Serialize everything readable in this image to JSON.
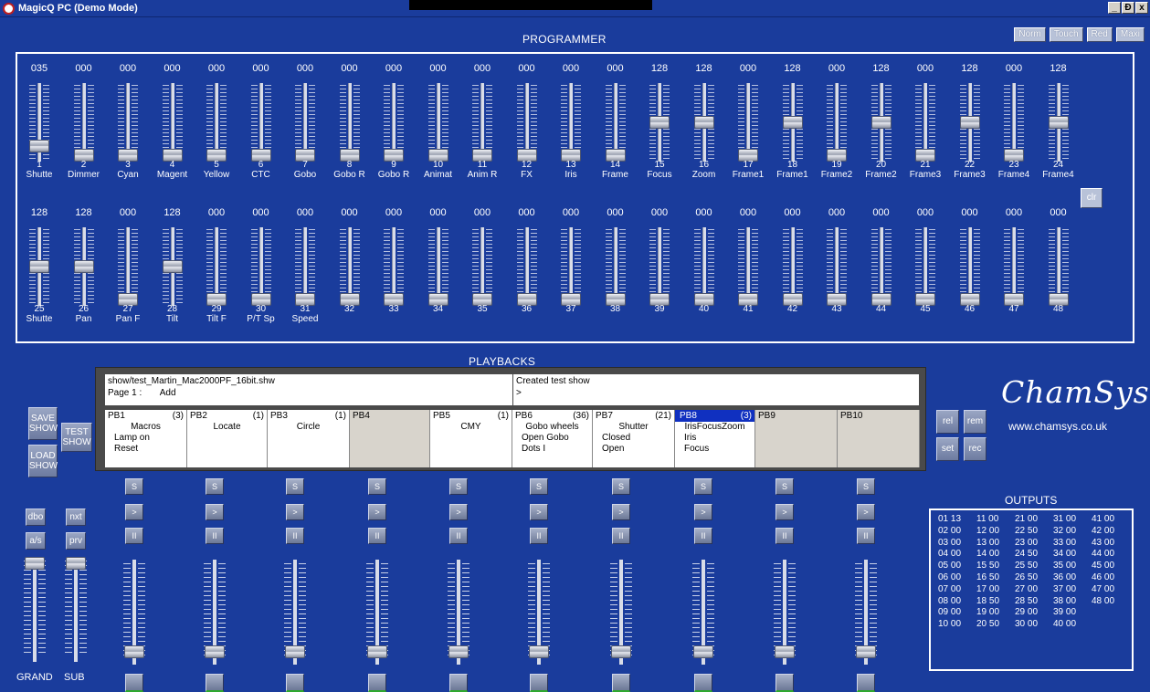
{
  "window": {
    "title": "MagicQ PC (Demo Mode)",
    "controls": [
      "_",
      "Ɖ",
      "x"
    ]
  },
  "modes": [
    "Norm",
    "Touch",
    "Red",
    "Maxi"
  ],
  "programmer": {
    "title": "PROGRAMMER",
    "clear_label": "clr",
    "row1": [
      {
        "value": "035",
        "num": "1",
        "label": "Shutte",
        "level": 35
      },
      {
        "value": "000",
        "num": "2",
        "label": "Dimmer",
        "level": 0
      },
      {
        "value": "000",
        "num": "3",
        "label": "Cyan",
        "level": 0
      },
      {
        "value": "000",
        "num": "4",
        "label": "Magent",
        "level": 0
      },
      {
        "value": "000",
        "num": "5",
        "label": "Yellow",
        "level": 0
      },
      {
        "value": "000",
        "num": "6",
        "label": "CTC",
        "level": 0
      },
      {
        "value": "000",
        "num": "7",
        "label": "Gobo",
        "level": 0
      },
      {
        "value": "000",
        "num": "8",
        "label": "Gobo R",
        "level": 0
      },
      {
        "value": "000",
        "num": "9",
        "label": "Gobo R",
        "level": 0
      },
      {
        "value": "000",
        "num": "10",
        "label": "Animat",
        "level": 0
      },
      {
        "value": "000",
        "num": "11",
        "label": "Anim R",
        "level": 0
      },
      {
        "value": "000",
        "num": "12",
        "label": "FX",
        "level": 0
      },
      {
        "value": "000",
        "num": "13",
        "label": "Iris",
        "level": 0
      },
      {
        "value": "000",
        "num": "14",
        "label": "Frame",
        "level": 0
      },
      {
        "value": "128",
        "num": "15",
        "label": "Focus",
        "level": 128
      },
      {
        "value": "128",
        "num": "16",
        "label": "Zoom",
        "level": 128
      },
      {
        "value": "000",
        "num": "17",
        "label": "Frame1",
        "level": 0
      },
      {
        "value": "128",
        "num": "18",
        "label": "Frame1",
        "level": 128
      },
      {
        "value": "000",
        "num": "19",
        "label": "Frame2",
        "level": 0
      },
      {
        "value": "128",
        "num": "20",
        "label": "Frame2",
        "level": 128
      },
      {
        "value": "000",
        "num": "21",
        "label": "Frame3",
        "level": 0
      },
      {
        "value": "128",
        "num": "22",
        "label": "Frame3",
        "level": 128
      },
      {
        "value": "000",
        "num": "23",
        "label": "Frame4",
        "level": 0
      },
      {
        "value": "128",
        "num": "24",
        "label": "Frame4",
        "level": 128
      }
    ],
    "row2": [
      {
        "value": "128",
        "num": "25",
        "label": "Shutte",
        "level": 128
      },
      {
        "value": "128",
        "num": "26",
        "label": "Pan",
        "level": 128
      },
      {
        "value": "000",
        "num": "27",
        "label": "Pan F",
        "level": 0
      },
      {
        "value": "128",
        "num": "28",
        "label": "Tilt",
        "level": 128
      },
      {
        "value": "000",
        "num": "29",
        "label": "Tilt F",
        "level": 0
      },
      {
        "value": "000",
        "num": "30",
        "label": "P/T Sp",
        "level": 0
      },
      {
        "value": "000",
        "num": "31",
        "label": "Speed",
        "level": 0
      },
      {
        "value": "000",
        "num": "32",
        "label": "",
        "level": 0
      },
      {
        "value": "000",
        "num": "33",
        "label": "",
        "level": 0
      },
      {
        "value": "000",
        "num": "34",
        "label": "",
        "level": 0
      },
      {
        "value": "000",
        "num": "35",
        "label": "",
        "level": 0
      },
      {
        "value": "000",
        "num": "36",
        "label": "",
        "level": 0
      },
      {
        "value": "000",
        "num": "37",
        "label": "",
        "level": 0
      },
      {
        "value": "000",
        "num": "38",
        "label": "",
        "level": 0
      },
      {
        "value": "000",
        "num": "39",
        "label": "",
        "level": 0
      },
      {
        "value": "000",
        "num": "40",
        "label": "",
        "level": 0
      },
      {
        "value": "000",
        "num": "41",
        "label": "",
        "level": 0
      },
      {
        "value": "000",
        "num": "42",
        "label": "",
        "level": 0
      },
      {
        "value": "000",
        "num": "43",
        "label": "",
        "level": 0
      },
      {
        "value": "000",
        "num": "44",
        "label": "",
        "level": 0
      },
      {
        "value": "000",
        "num": "45",
        "label": "",
        "level": 0
      },
      {
        "value": "000",
        "num": "46",
        "label": "",
        "level": 0
      },
      {
        "value": "000",
        "num": "47",
        "label": "",
        "level": 0
      },
      {
        "value": "000",
        "num": "48",
        "label": "",
        "level": 0
      }
    ]
  },
  "playbacks": {
    "title": "PLAYBACKS",
    "show_file": "show/test_Martin_Mac2000PF_16bit.shw",
    "page_label": "Page 1 :",
    "page_action": "Add",
    "status": "Created test show",
    "prompt": ">",
    "items": [
      {
        "name": "PB1",
        "count": "(3)",
        "lines": [
          "Macros",
          "Lamp on",
          "Reset"
        ],
        "empty": false,
        "selected": false
      },
      {
        "name": "PB2",
        "count": "(1)",
        "lines": [
          "",
          "Locate",
          ""
        ],
        "empty": false,
        "selected": false
      },
      {
        "name": "PB3",
        "count": "(1)",
        "lines": [
          "",
          "Circle",
          ""
        ],
        "empty": false,
        "selected": false
      },
      {
        "name": "PB4",
        "count": "",
        "lines": [
          "",
          "",
          ""
        ],
        "empty": true,
        "selected": false
      },
      {
        "name": "PB5",
        "count": "(1)",
        "lines": [
          "",
          "CMY",
          ""
        ],
        "empty": false,
        "selected": false
      },
      {
        "name": "PB6",
        "count": "(36)",
        "lines": [
          "Gobo wheels",
          "Open Gobo",
          "Dots I"
        ],
        "empty": false,
        "selected": false
      },
      {
        "name": "PB7",
        "count": "(21)",
        "lines": [
          "Shutter",
          "Closed",
          "Open"
        ],
        "empty": false,
        "selected": false
      },
      {
        "name": "PB8",
        "count": "(3)",
        "lines": [
          "IrisFocusZoom",
          "Iris",
          "Focus"
        ],
        "empty": false,
        "selected": true
      },
      {
        "name": "PB9",
        "count": "",
        "lines": [
          "",
          "",
          ""
        ],
        "empty": true,
        "selected": false
      },
      {
        "name": "PB10",
        "count": "",
        "lines": [
          "",
          "",
          ""
        ],
        "empty": true,
        "selected": false
      }
    ],
    "controls": {
      "s": "S",
      "go": ">",
      "pause": "II"
    },
    "side_buttons": {
      "save": "SAVE SHOW",
      "load": "LOAD SHOW",
      "test": "TEST SHOW"
    },
    "right_buttons": {
      "rel": "rel",
      "rem": "rem",
      "set": "set",
      "rec": "rec"
    },
    "left_buttons": {
      "dbo": "dbo",
      "nxt": "nxt",
      "as": "a/s",
      "prv": "prv"
    },
    "grand_label": "GRAND",
    "sub_label": "SUB"
  },
  "brand": {
    "logo": "ChamSys",
    "url": "www.chamsys.co.uk"
  },
  "outputs": {
    "title": "OUTPUTS",
    "cells": [
      "01 13",
      "11 00",
      "21 00",
      "31 00",
      "41 00",
      "02 00",
      "12 00",
      "22 50",
      "32 00",
      "42 00",
      "03 00",
      "13 00",
      "23 00",
      "33 00",
      "43 00",
      "04 00",
      "14 00",
      "24 50",
      "34 00",
      "44 00",
      "05 00",
      "15 50",
      "25 50",
      "35 00",
      "45 00",
      "06 00",
      "16 50",
      "26 50",
      "36 00",
      "46 00",
      "07 00",
      "17 00",
      "27 00",
      "37 00",
      "47 00",
      "08 00",
      "18 50",
      "28 50",
      "38 00",
      "48 00",
      "09 00",
      "19 00",
      "29 00",
      "39 00",
      "",
      "10 00",
      "20 50",
      "30 00",
      "40 00",
      ""
    ]
  },
  "colors": {
    "background": "#1a3c9c",
    "selected": "#1030c0",
    "empty_cell": "#d8d4cc"
  }
}
